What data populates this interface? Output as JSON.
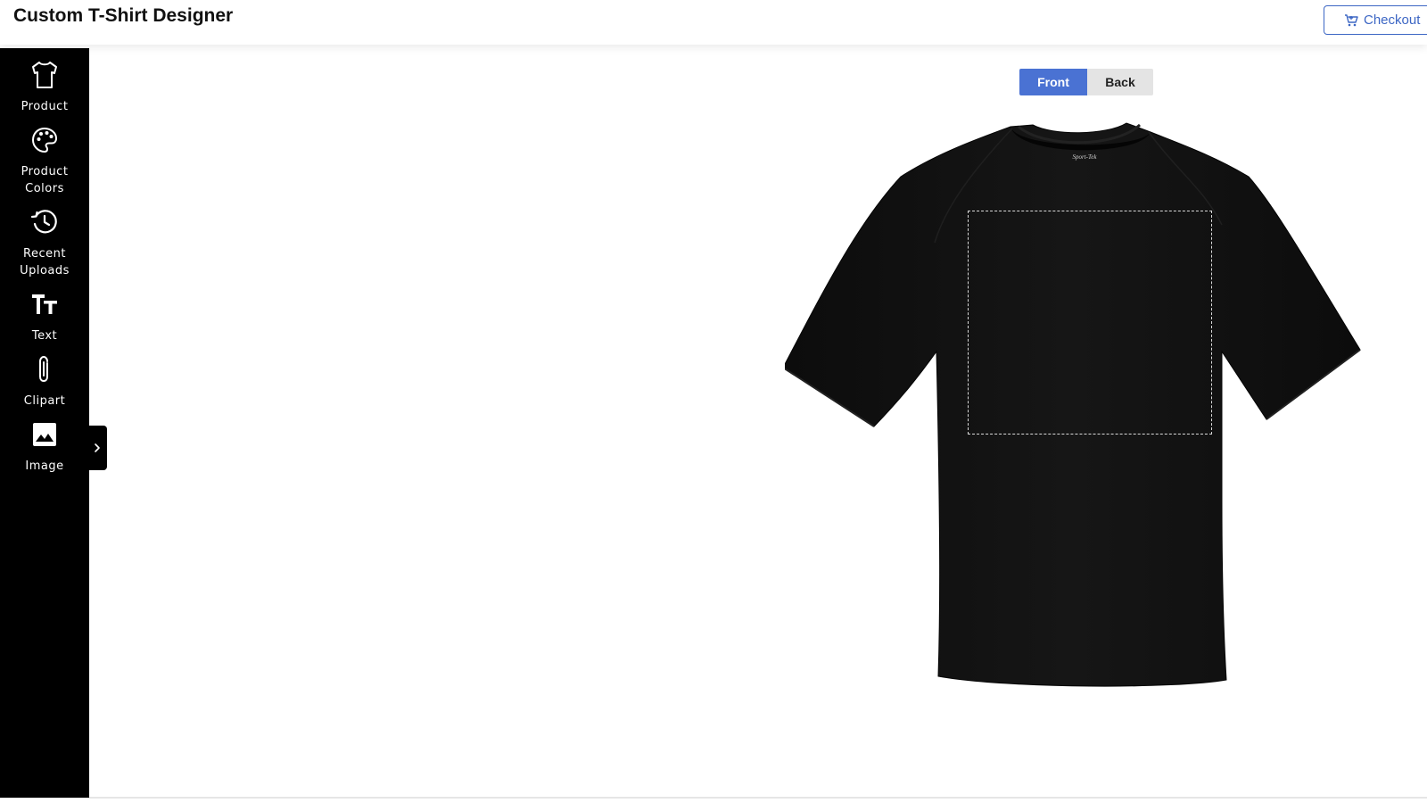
{
  "header": {
    "title": "Custom T-Shirt Designer",
    "checkout_label": "Checkout"
  },
  "sidebar": {
    "items": [
      {
        "label": "Product",
        "icon": "tshirt-icon"
      },
      {
        "label": "Product\nColors",
        "icon": "palette-icon"
      },
      {
        "label": "Recent\nUploads",
        "icon": "history-icon"
      },
      {
        "label": "Text",
        "icon": "text-icon"
      },
      {
        "label": "Clipart",
        "icon": "paperclip-icon"
      },
      {
        "label": "Image",
        "icon": "image-icon"
      }
    ],
    "collapse_icon": "chevron-right-icon"
  },
  "canvas": {
    "views": {
      "front_label": "Front",
      "back_label": "Back",
      "selected": "Front"
    },
    "shirt": {
      "color": "#111111",
      "neck_tag_brand": "Sport-Tek"
    }
  },
  "colors": {
    "accent": "#4a72d3",
    "sidebar_bg": "#000000",
    "checkout_border": "#3c66c4"
  }
}
